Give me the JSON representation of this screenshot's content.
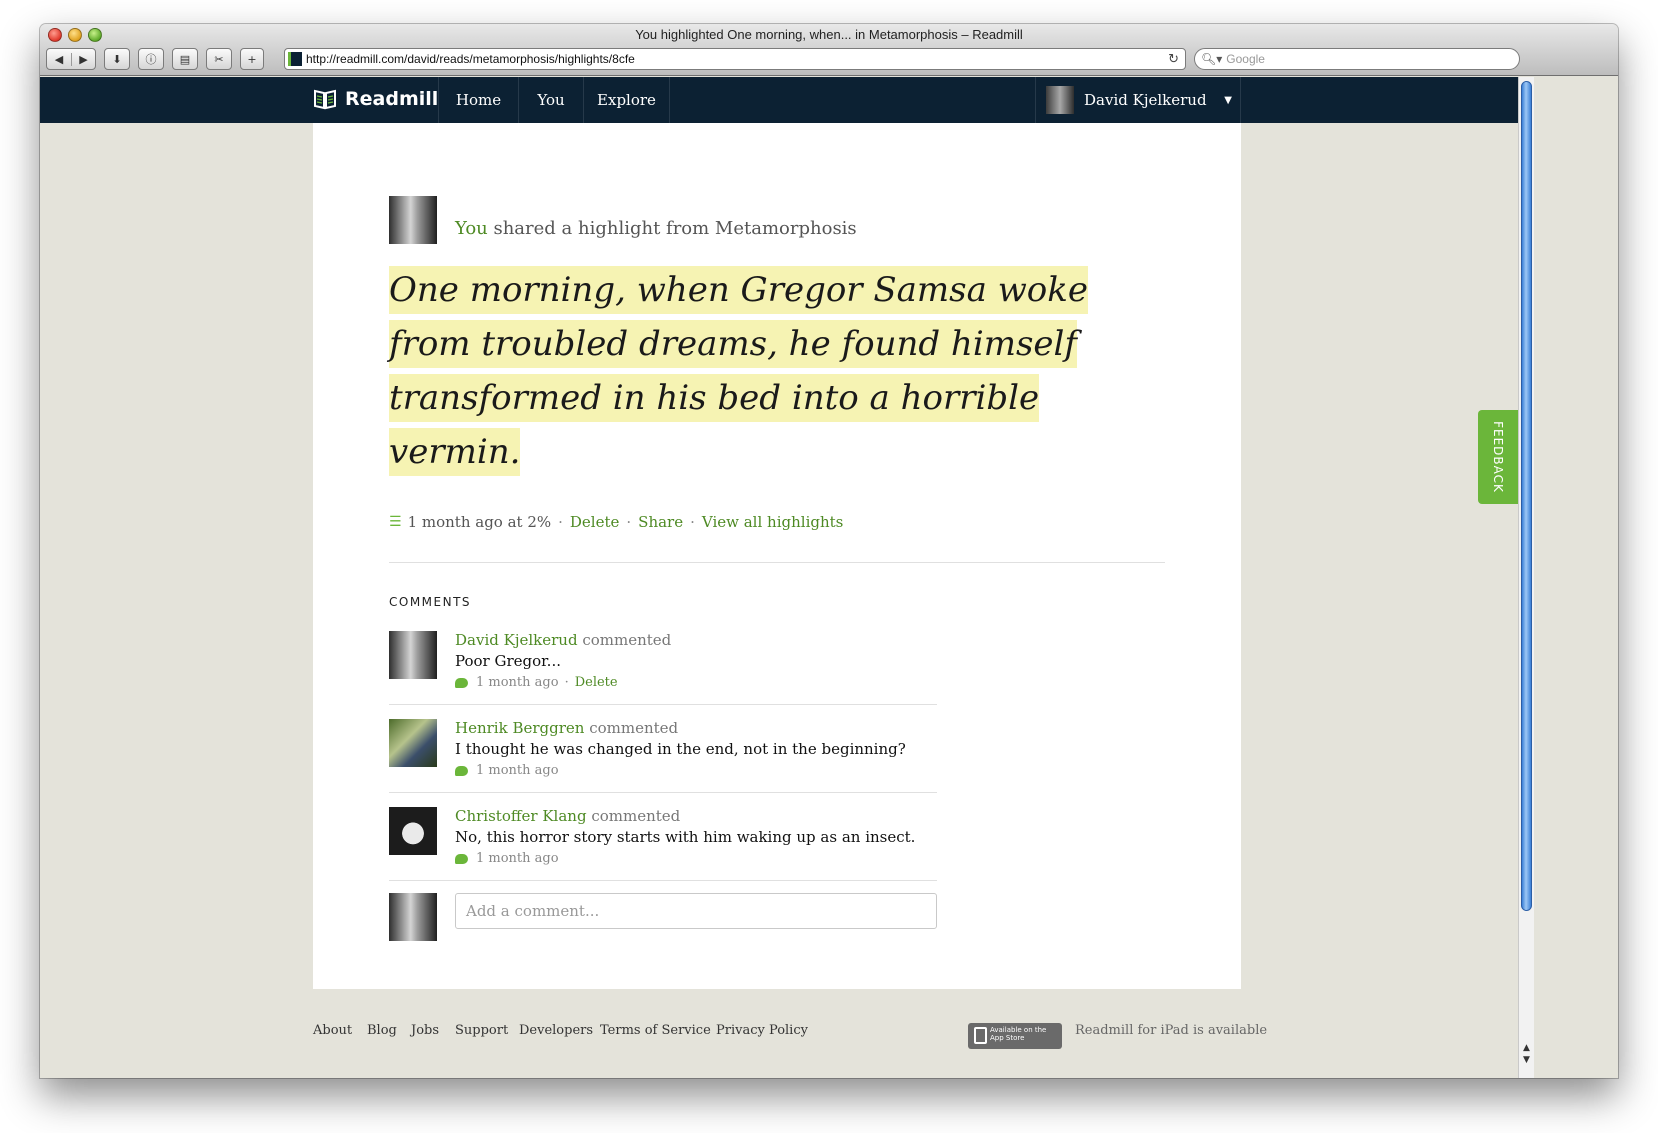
{
  "browser": {
    "window_title": "You highlighted One morning, when... in Metamorphosis – Readmill",
    "url": "http://readmill.com/david/reads/metamorphosis/highlights/8cfe",
    "search_placeholder": "Google",
    "buttons": {
      "add": "+"
    }
  },
  "nav": {
    "brand": "Readmill",
    "links": [
      "Home",
      "You",
      "Explore"
    ],
    "user_name": "David Kjelkerud"
  },
  "highlight": {
    "actor": "You",
    "headline_rest": " shared a highlight from Metamorphosis",
    "quote": "One morning, when Gregor Samsa woke from troubled dreams, he found himself transformed in his bed into a horrible vermin.",
    "meta": {
      "time": "1 month ago at 2%",
      "delete": "Delete",
      "share": "Share",
      "view_all": "View all highlights"
    }
  },
  "comments": {
    "title": "COMMENTS",
    "items": [
      {
        "author": "David Kjelkerud",
        "verb": "commented",
        "text": "Poor Gregor...",
        "time": "1 month ago",
        "action": "Delete"
      },
      {
        "author": "Henrik Berggren",
        "verb": "commented",
        "text": "I thought he was changed in the end, not in the beginning?",
        "time": "1 month ago"
      },
      {
        "author": "Christoffer Klang",
        "verb": "commented",
        "text": "No, this horror story starts with him waking up as an insect.",
        "time": "1 month ago"
      }
    ],
    "add_placeholder": "Add a comment..."
  },
  "feedback": "FEEDBACK",
  "footer": {
    "links": [
      "About",
      "Blog",
      "Jobs",
      "Support",
      "Developers",
      "Terms of Service",
      "Privacy Policy"
    ],
    "appstore_badge": "Available on the App Store",
    "ipad_text": "Readmill for iPad is available"
  },
  "colors": {
    "nav_bg": "#0c2133",
    "accent_green": "#4e8a24",
    "highlight_bg": "#f6f3b3",
    "page_bg": "#e4e3da"
  }
}
